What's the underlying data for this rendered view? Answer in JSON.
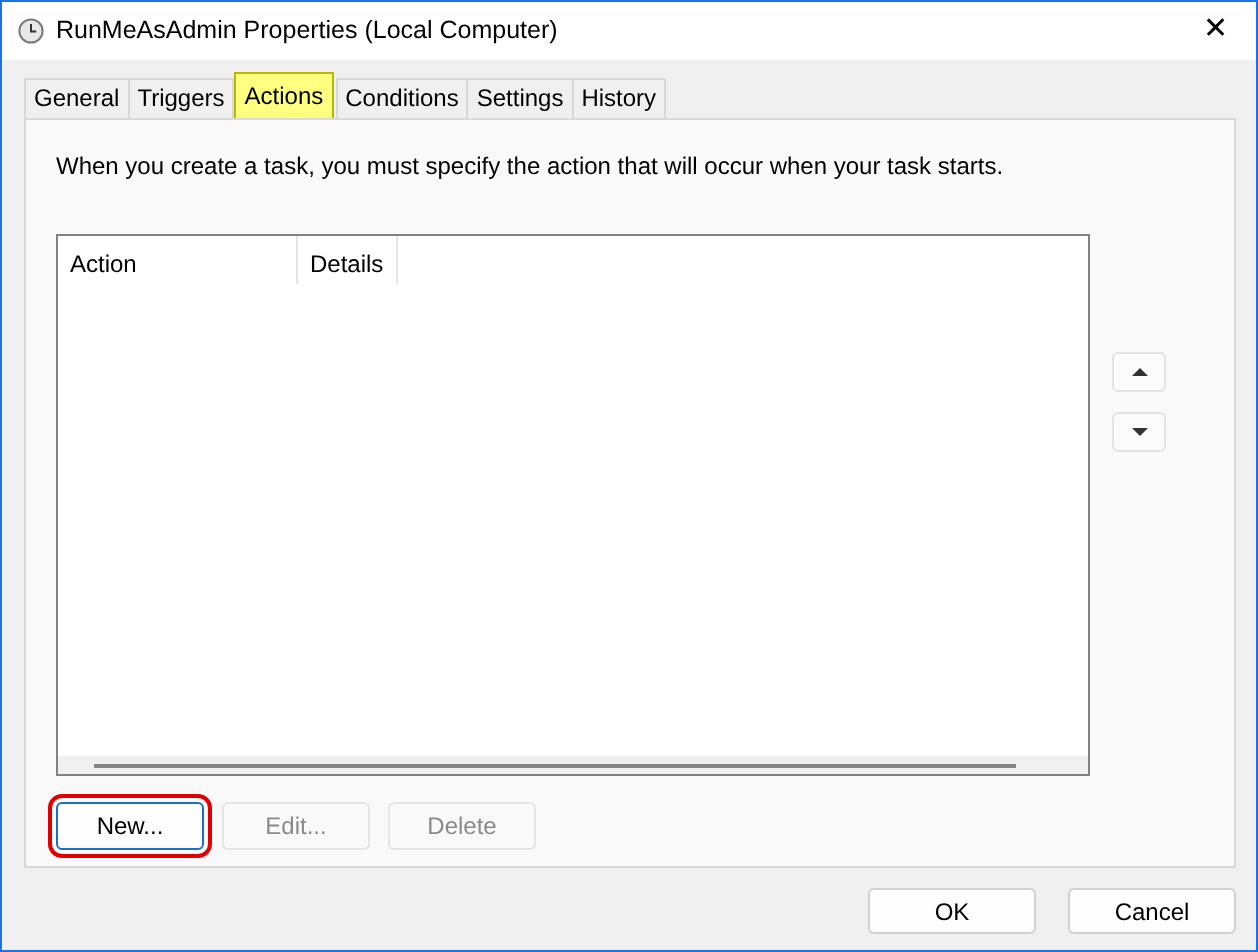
{
  "window": {
    "title": "RunMeAsAdmin Properties (Local Computer)",
    "close": "✕"
  },
  "tabs": [
    {
      "label": "General",
      "selected": false,
      "highlighted": false
    },
    {
      "label": "Triggers",
      "selected": false,
      "highlighted": false
    },
    {
      "label": "Actions",
      "selected": true,
      "highlighted": true
    },
    {
      "label": "Conditions",
      "selected": false,
      "highlighted": false
    },
    {
      "label": "Settings",
      "selected": false,
      "highlighted": false
    },
    {
      "label": "History",
      "selected": false,
      "highlighted": false
    }
  ],
  "description": "When you create a task, you must specify the action that will occur when your task starts.",
  "table": {
    "columns": [
      "Action",
      "Details"
    ]
  },
  "list_buttons": [
    {
      "label": "New...",
      "disabled": false,
      "highlighted": true
    },
    {
      "label": "Edit...",
      "disabled": true,
      "highlighted": false
    },
    {
      "label": "Delete",
      "disabled": true,
      "highlighted": false
    }
  ],
  "footer_buttons": [
    "OK",
    "Cancel"
  ]
}
